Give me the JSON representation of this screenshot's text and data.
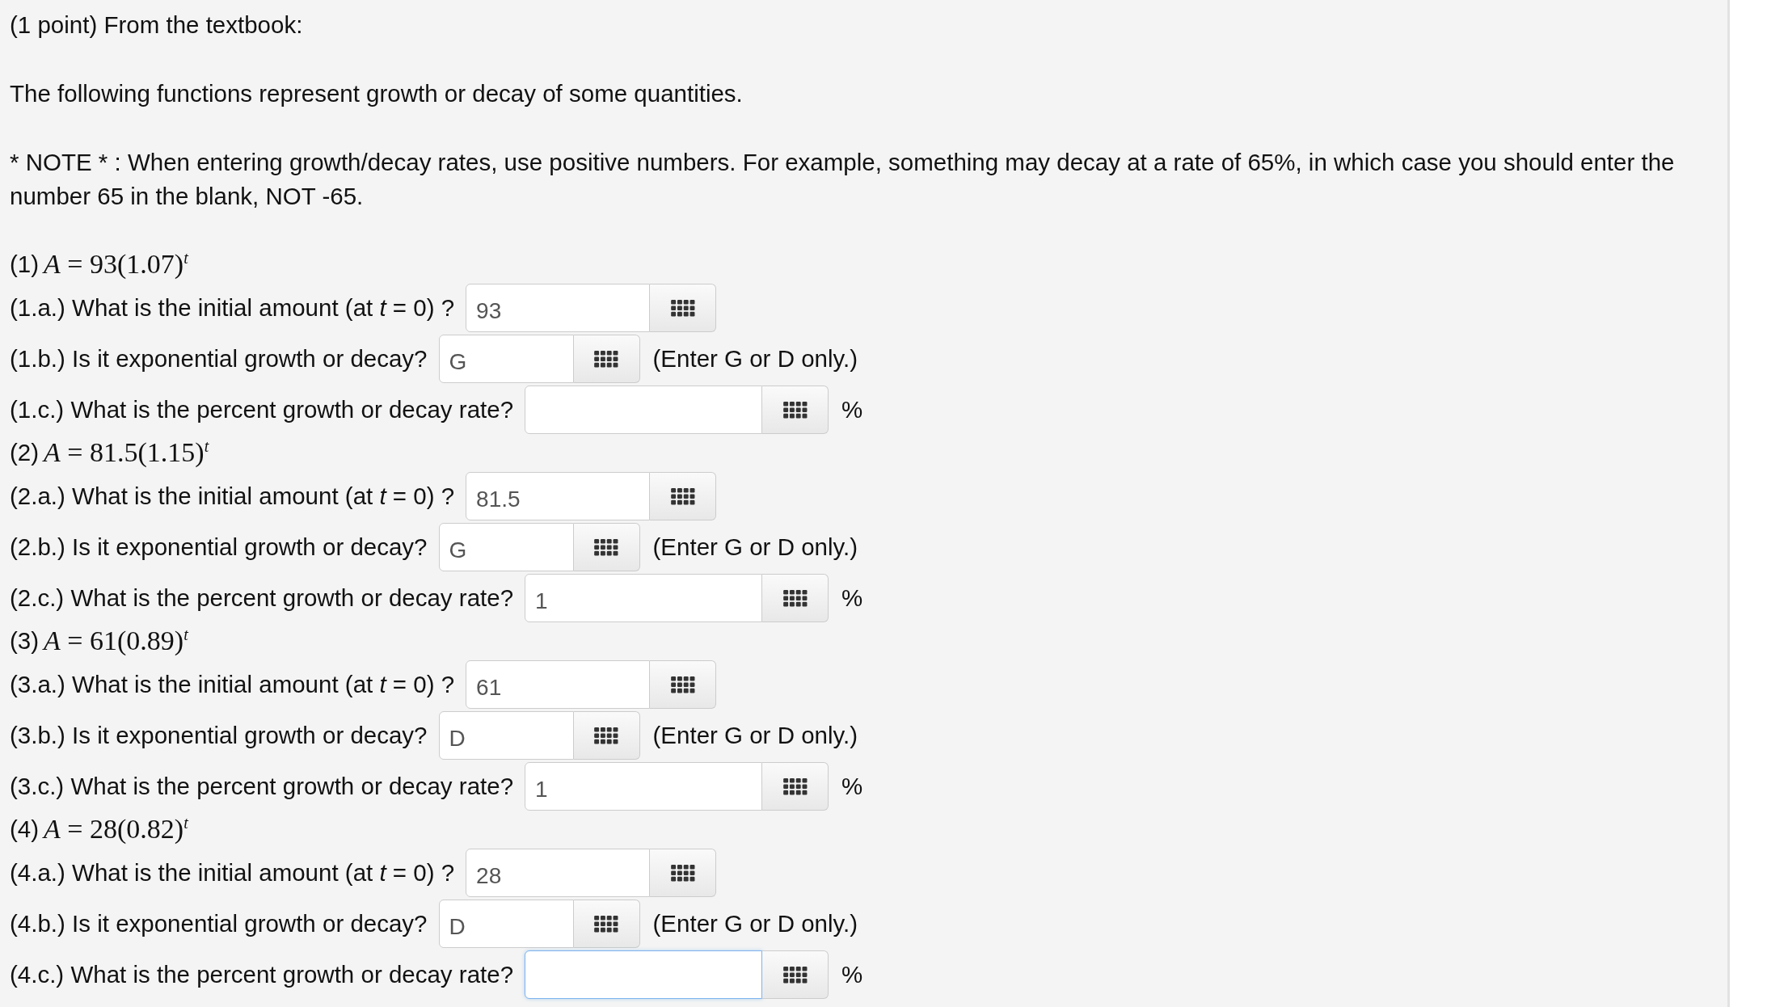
{
  "heading": "(1 point) From the textbook:",
  "intro": "The following functions represent growth or decay of some quantities.",
  "note": "* NOTE * : When entering growth/decay rates, use positive numbers. For example, something may decay at a rate of 65%, in which case you should enter the number 65 in the blank, NOT -65.",
  "problems": [
    {
      "number": "(1)",
      "formula": "*A* = 93(1.07)$^{t}$",
      "questions": [
        {
          "label": "(1.a.) What is the initial amount (at *t* = 0) ?",
          "value": "93",
          "focused": false
        },
        {
          "label": "(1.b.) Is it exponential growth or decay?",
          "value": "G",
          "focused": false,
          "suffix": "(Enter G or D only.)"
        },
        {
          "label": "(1.c.) What is the percent growth or decay rate?",
          "focused": false,
          "suffix": "%"
        }
      ]
    },
    {
      "number": "(2)",
      "formula": "*A* = 81.5(1.15)$^{t}$",
      "questions": [
        {
          "label": "(2.a.) What is the initial amount (at *t* = 0) ?",
          "value": "81.5",
          "focused": false
        },
        {
          "label": "(2.b.) Is it exponential growth or decay?",
          "value": "G",
          "focused": false,
          "suffix": "(Enter G or D only.)"
        },
        {
          "label": "(2.c.) What is the percent growth or decay rate?",
          "value": "1",
          "focused": false,
          "suffix": "%"
        }
      ]
    },
    {
      "number": "(3)",
      "formula": "*A* = 61(0.89)$^{t}$",
      "questions": [
        {
          "label": "(3.a.) What is the initial amount (at *t* = 0) ?",
          "value": "61",
          "focused": false
        },
        {
          "label": "(3.b.) Is it exponential growth or decay?",
          "value": "D",
          "focused": false,
          "suffix": "(Enter G or D only.)"
        },
        {
          "label": "(3.c.) What is the percent growth or decay rate?",
          "value": "1",
          "focused": false,
          "suffix": "%"
        }
      ]
    },
    {
      "number": "(4)",
      "formula": "*A* = 28(0.82)$^{t}$",
      "questions": [
        {
          "label": "(4.a.) What is the initial amount (at *t* = 0) ?",
          "value": "28",
          "focused": false
        },
        {
          "label": "(4.b.) Is it exponential growth or decay?",
          "value": "D",
          "focused": false,
          "suffix": "(Enter G or D only.)"
        },
        {
          "label": "(4.c.) What is the percent growth or decay rate?",
          "focused": true,
          "suffix": "%"
        }
      ]
    }
  ]
}
